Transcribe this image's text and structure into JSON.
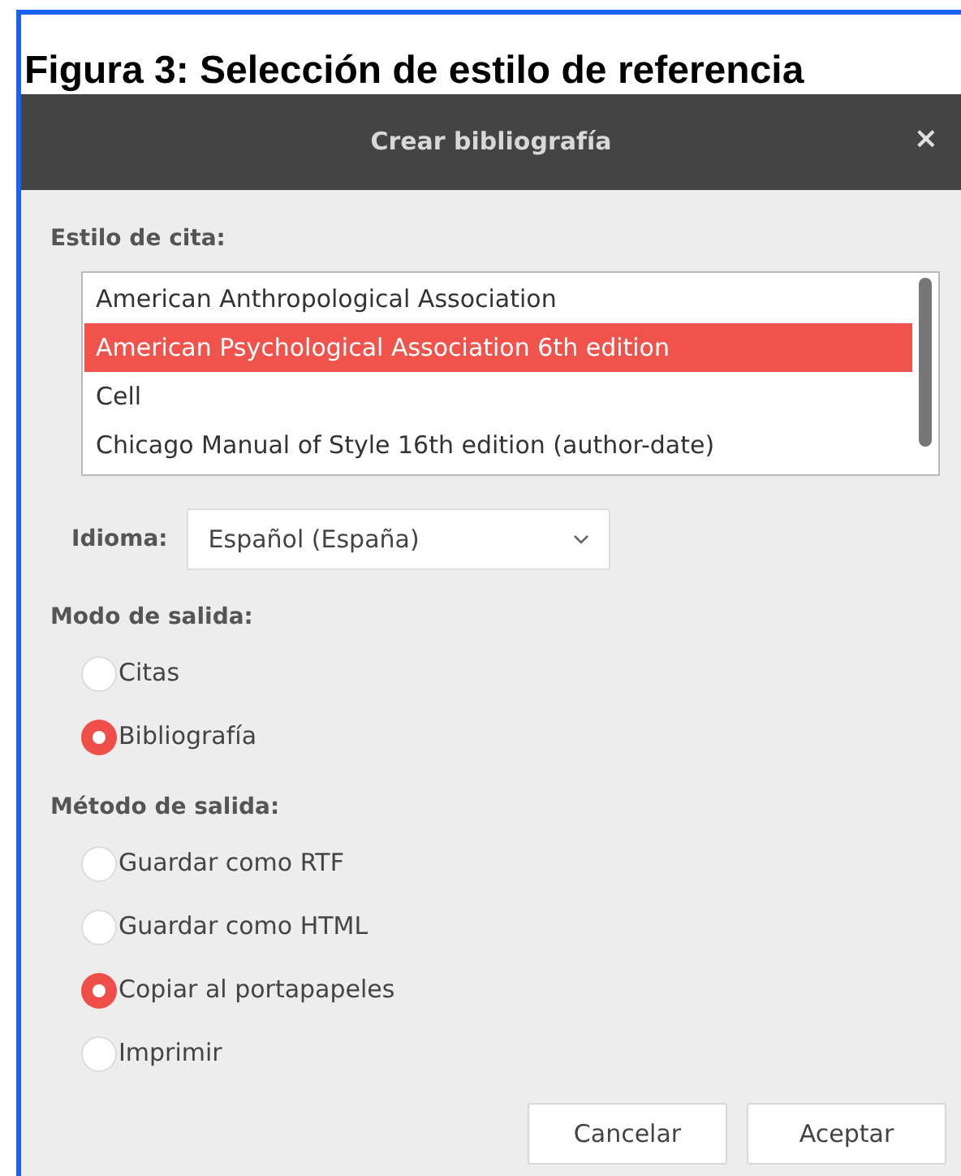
{
  "caption": "Figura 3: Selección de estilo de referencia",
  "window": {
    "title": "Crear bibliografía",
    "close": "×"
  },
  "citation_style": {
    "label": "Estilo de cita:",
    "items": [
      {
        "label": "American Anthropological Association",
        "selected": false
      },
      {
        "label": "American Psychological Association 6th edition",
        "selected": true
      },
      {
        "label": "Cell",
        "selected": false
      },
      {
        "label": "Chicago Manual of Style 16th edition (author-date)",
        "selected": false
      }
    ]
  },
  "language": {
    "label": "Idioma:",
    "value": "Español (España)"
  },
  "output_mode": {
    "label": "Modo de salida:",
    "options": [
      {
        "label": "Citas",
        "selected": false
      },
      {
        "label": "Bibliografía",
        "selected": true
      }
    ]
  },
  "output_method": {
    "label": "Método de salida:",
    "options": [
      {
        "label": "Guardar como RTF",
        "selected": false
      },
      {
        "label": "Guardar como HTML",
        "selected": false
      },
      {
        "label": "Copiar al portapapeles",
        "selected": true
      },
      {
        "label": "Imprimir",
        "selected": false
      }
    ]
  },
  "buttons": [
    "Cancelar",
    "Aceptar"
  ]
}
